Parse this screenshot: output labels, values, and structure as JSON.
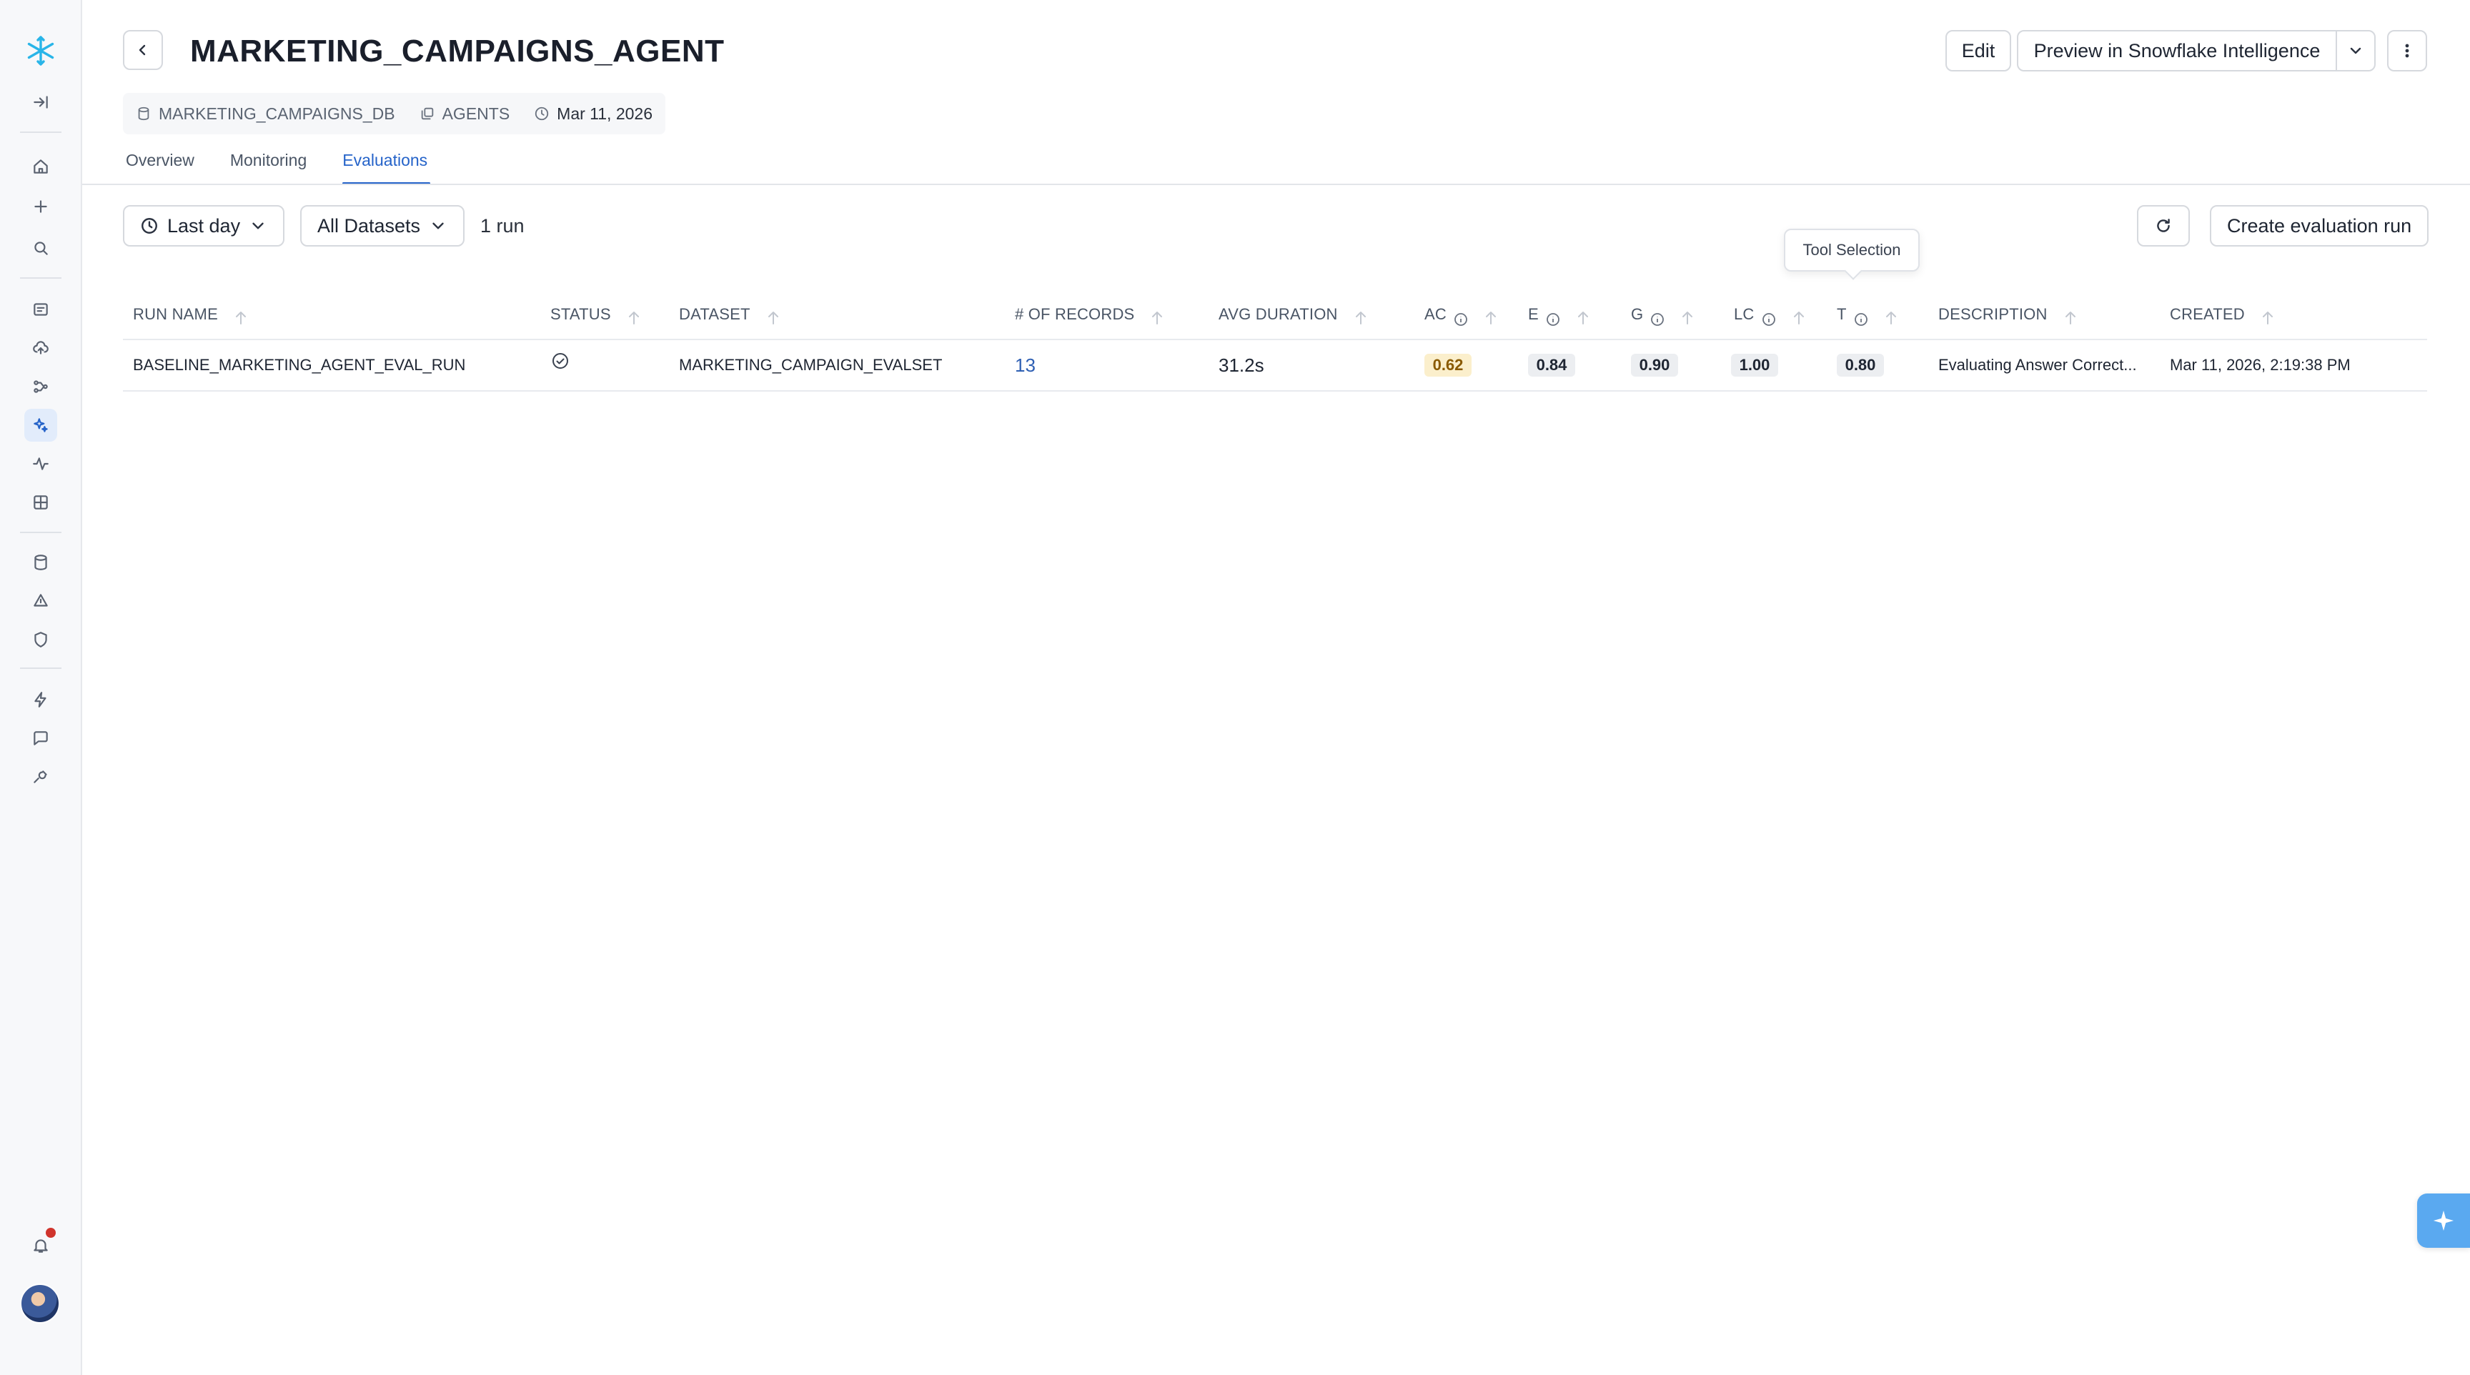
{
  "header": {
    "title": "MARKETING_CAMPAIGNS_AGENT",
    "meta": {
      "database": "MARKETING_CAMPAIGNS_DB",
      "schema": "AGENTS",
      "date": "Mar 11, 2026"
    },
    "buttons": {
      "edit": "Edit",
      "preview": "Preview in Snowflake Intelligence"
    }
  },
  "tabs": [
    {
      "label": "Overview"
    },
    {
      "label": "Monitoring"
    },
    {
      "label": "Evaluations"
    }
  ],
  "toolbar": {
    "time_range": "Last day",
    "dataset_filter": "All Datasets",
    "run_count": "1 run",
    "create_label": "Create evaluation run"
  },
  "tooltip": "Tool Selection",
  "table": {
    "headers": {
      "run_name": "RUN NAME",
      "status": "STATUS",
      "dataset": "DATASET",
      "records": "# OF RECORDS",
      "avg_duration": "AVG DURATION",
      "ac": "AC",
      "e": "E",
      "g": "G",
      "lc": "LC",
      "t": "T",
      "description": "DESCRIPTION",
      "created": "CREATED"
    },
    "rows": [
      {
        "run_name": "BASELINE_MARKETING_AGENT_EVAL_RUN",
        "status": "completed",
        "dataset": "MARKETING_CAMPAIGN_EVALSET",
        "records": "13",
        "avg_duration": "31.2s",
        "ac": "0.62",
        "e": "0.84",
        "g": "0.90",
        "lc": "1.00",
        "t": "0.80",
        "description": "Evaluating Answer Correct...",
        "created": "Mar 11, 2026, 2:19:38 PM"
      }
    ]
  },
  "icons": {
    "logo": "snowflake-icon",
    "active_nav": "ai-sparkle-icon"
  },
  "colors": {
    "accent": "#2563c9",
    "logo": "#29b5e8",
    "warn_badge": "#fbefcc",
    "notification": "#d0342c"
  }
}
